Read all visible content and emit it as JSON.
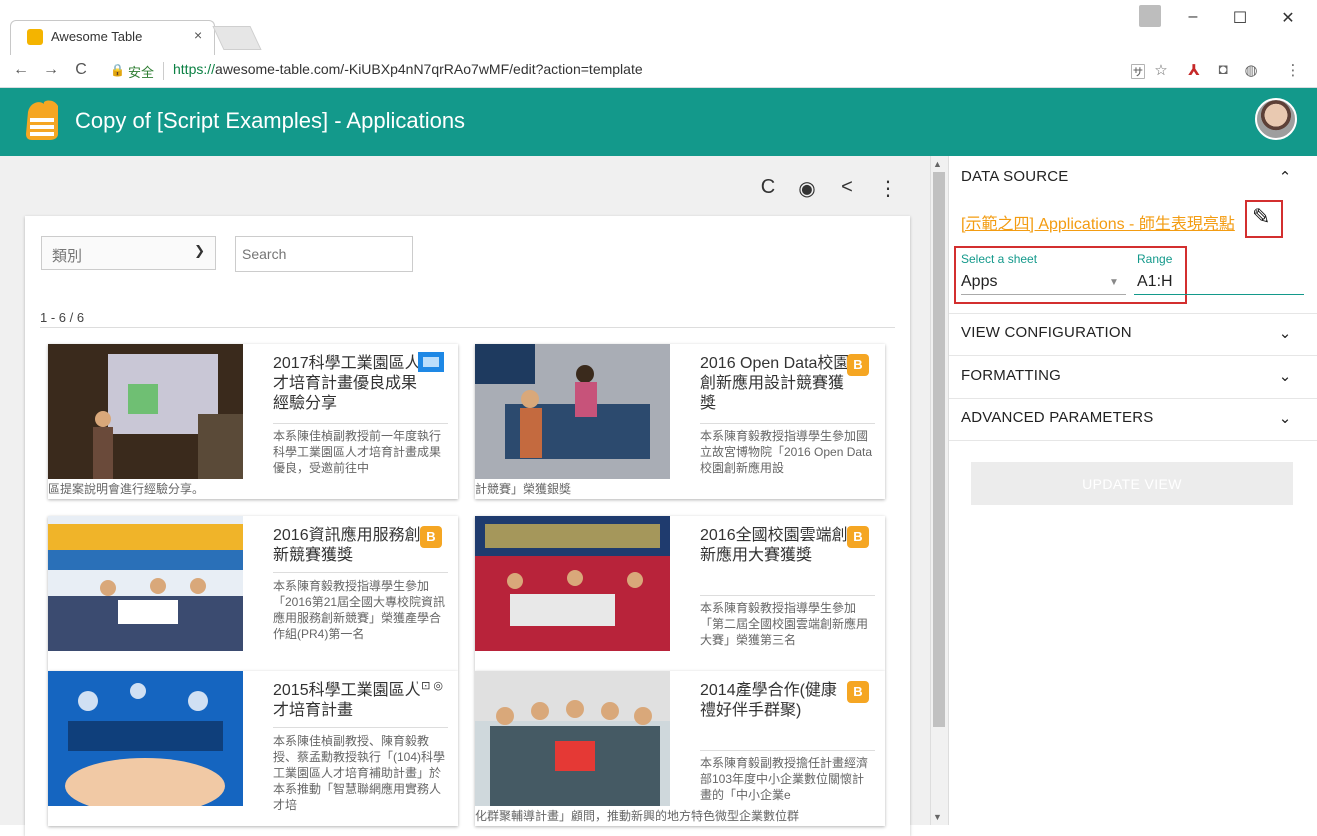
{
  "browser": {
    "tab_title": "Awesome Table",
    "tab_close": "×",
    "nav": {
      "back": "←",
      "forward": "→",
      "reload": "C"
    },
    "secure_label": "安全",
    "url_scheme": "https://",
    "url_rest": "awesome-table.com/-KiUBXp4nN7qrRAo7wMF/edit?action=template",
    "window_controls": {
      "minimize": "–",
      "maximize": "☐",
      "close": "✕"
    },
    "extensions": [
      "translate-icon",
      "star-icon",
      "acrobat-icon",
      "camera-icon",
      "extension-icon",
      "menu-icon"
    ]
  },
  "app": {
    "title": "Copy of [Script Examples] - Applications"
  },
  "toolbar": {
    "refresh": "C",
    "preview": "◉",
    "share": "<",
    "more": "⋮"
  },
  "filters": {
    "category_placeholder": "類別",
    "search_placeholder": "Search"
  },
  "results": {
    "count": "1 - 6 / 6"
  },
  "items": [
    {
      "title": "2017科學工業園區人才培育計畫優良成果經驗分享",
      "desc": "本系陳佳楨副教授前一年度執行科學工業園區人才培育計畫成果優良，受邀前往中",
      "overflow": "區提案說明會進行經驗分享。",
      "icon": "slides"
    },
    {
      "title": "2016 Open Data校園創新應用設計競賽獲獎",
      "desc": "本系陳育毅教授指導學生參加國立故宮博物院「2016 Open Data校園創新應用設",
      "overflow": "計競賽」榮獲銀獎",
      "icon": "blogger"
    },
    {
      "title": "2016資訊應用服務創新競賽獲獎",
      "desc": "本系陳育毅教授指導學生參加「2016第21屆全國大專校院資訊應用服務創新競賽」榮獲產學合作組(PR4)第一名",
      "overflow": "",
      "icon": "blogger"
    },
    {
      "title": "2016全國校園雲端創新應用大賽獲獎",
      "desc": "本系陳育毅教授指導學生參加「第二屆全國校園雲端創新應用大賽」榮獲第三名",
      "overflow": "",
      "icon": "blogger"
    },
    {
      "title": "2015科學工業園區人才培育計畫",
      "desc": "本系陳佳楨副教授、陳育毅教授、蔡孟勳教授執行「(104)科學工業園區人才培育補助計畫」於本系推動「智慧聯網應用實務人才培",
      "overflow": "",
      "icon": "sub"
    },
    {
      "title": "2014產學合作(健康禮好伴手群聚)",
      "desc": "本系陳育毅副教授擔任計畫經濟部103年度中小企業數位關懷計畫的「中小企業e",
      "overflow": "化群聚輔導計畫」顧問，推動新興的地方特色微型企業數位群",
      "icon": "blogger"
    }
  ],
  "panel": {
    "data_source": {
      "heading": "DATA SOURCE",
      "link": "[示範之四] Applications - 師生表現亮點",
      "sheet_label": "Select a sheet",
      "sheet_value": "Apps",
      "range_label": "Range",
      "range_value": "A1:H"
    },
    "view_config": "VIEW CONFIGURATION",
    "formatting": "FORMATTING",
    "advanced": "ADVANCED PARAMETERS",
    "update_btn": "UPDATE VIEW"
  },
  "colors": {
    "brand_teal": "#13998b",
    "link_orange": "#f39c12",
    "highlight_red": "#d32f2f"
  }
}
